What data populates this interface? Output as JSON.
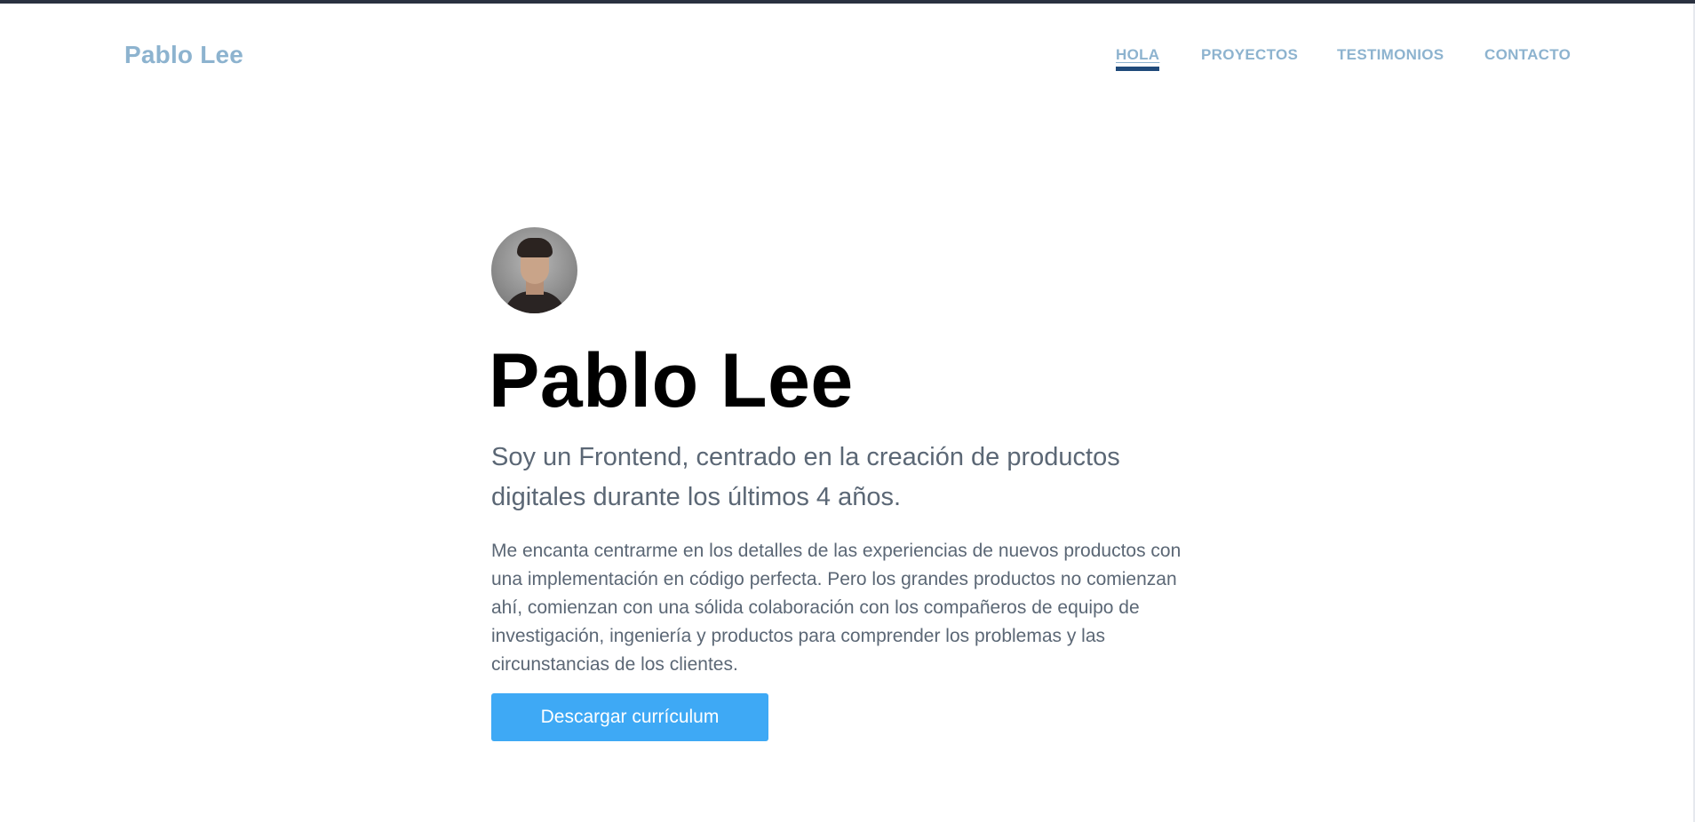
{
  "header": {
    "brand": "Pablo Lee",
    "nav": [
      {
        "label": "HOLA",
        "active": true
      },
      {
        "label": "PROYECTOS",
        "active": false
      },
      {
        "label": "TESTIMONIOS",
        "active": false
      },
      {
        "label": "CONTACTO",
        "active": false
      }
    ]
  },
  "hero": {
    "name": "Pablo Lee",
    "tagline": "Soy un Frontend, centrado en la creación de productos digitales durante los últimos 4 años.",
    "description": "Me encanta centrarme en los detalles de las experiencias de nuevos productos con una implementación en código perfecta. Pero los grandes productos no comienzan ahí, comienzan con una sólida colaboración con los compañeros de equipo de investigación, ingeniería y productos para comprender los problemas y las circunstancias de los clientes.",
    "cta_label": "Descargar currículum"
  },
  "colors": {
    "brand": "#8db3cf",
    "nav_active_underline": "#1f4a7a",
    "cta_background": "#3ea9f5",
    "body_text": "#5b6775",
    "heading": "#000000"
  }
}
